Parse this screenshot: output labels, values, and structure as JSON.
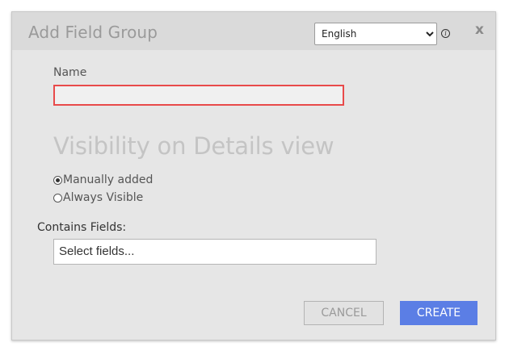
{
  "dialog": {
    "title": "Add Field Group",
    "language": {
      "selected": "English",
      "options": [
        "English"
      ]
    },
    "info_icon": "info-icon",
    "close_label": "x"
  },
  "form": {
    "name_label": "Name",
    "name_value": "",
    "visibility_heading": "Visibility on Details view",
    "visibility_options": [
      {
        "label": "Manually added",
        "checked": true
      },
      {
        "label": "Always Visible",
        "checked": false
      }
    ],
    "contains_label": "Contains Fields:",
    "fields_placeholder": "Select fields..."
  },
  "buttons": {
    "cancel_label": "CANCEL",
    "create_label": "CREATE"
  },
  "colors": {
    "error_border": "#e84a4a",
    "primary": "#5b7ee5"
  }
}
